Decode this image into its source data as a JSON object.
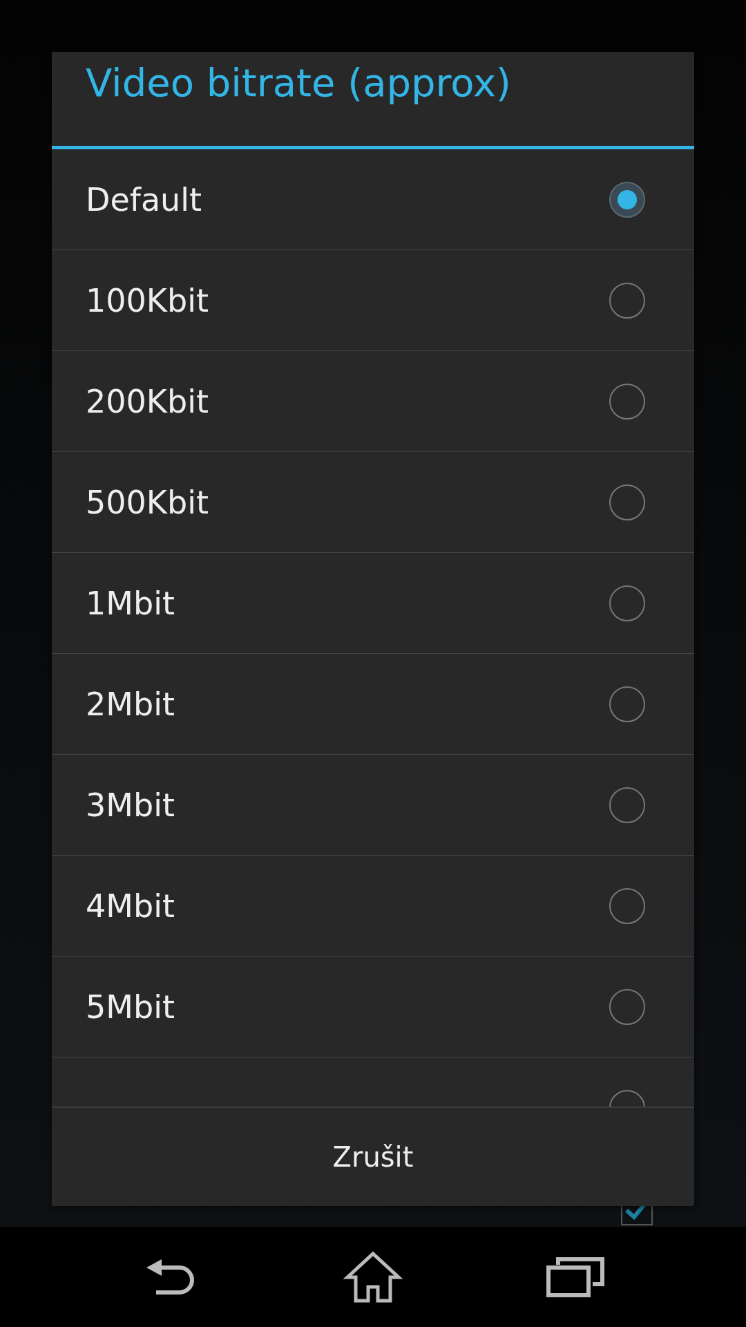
{
  "background": {
    "record_audio": {
      "checked": true
    }
  },
  "dialog": {
    "title": "Video bitrate (approx)",
    "options": [
      {
        "label": "Default",
        "selected": true
      },
      {
        "label": "100Kbit",
        "selected": false
      },
      {
        "label": "200Kbit",
        "selected": false
      },
      {
        "label": "500Kbit",
        "selected": false
      },
      {
        "label": "1Mbit",
        "selected": false
      },
      {
        "label": "2Mbit",
        "selected": false
      },
      {
        "label": "3Mbit",
        "selected": false
      },
      {
        "label": "4Mbit",
        "selected": false
      },
      {
        "label": "5Mbit",
        "selected": false
      },
      {
        "selected": false
      }
    ],
    "cancel_button": "Zrušit"
  }
}
